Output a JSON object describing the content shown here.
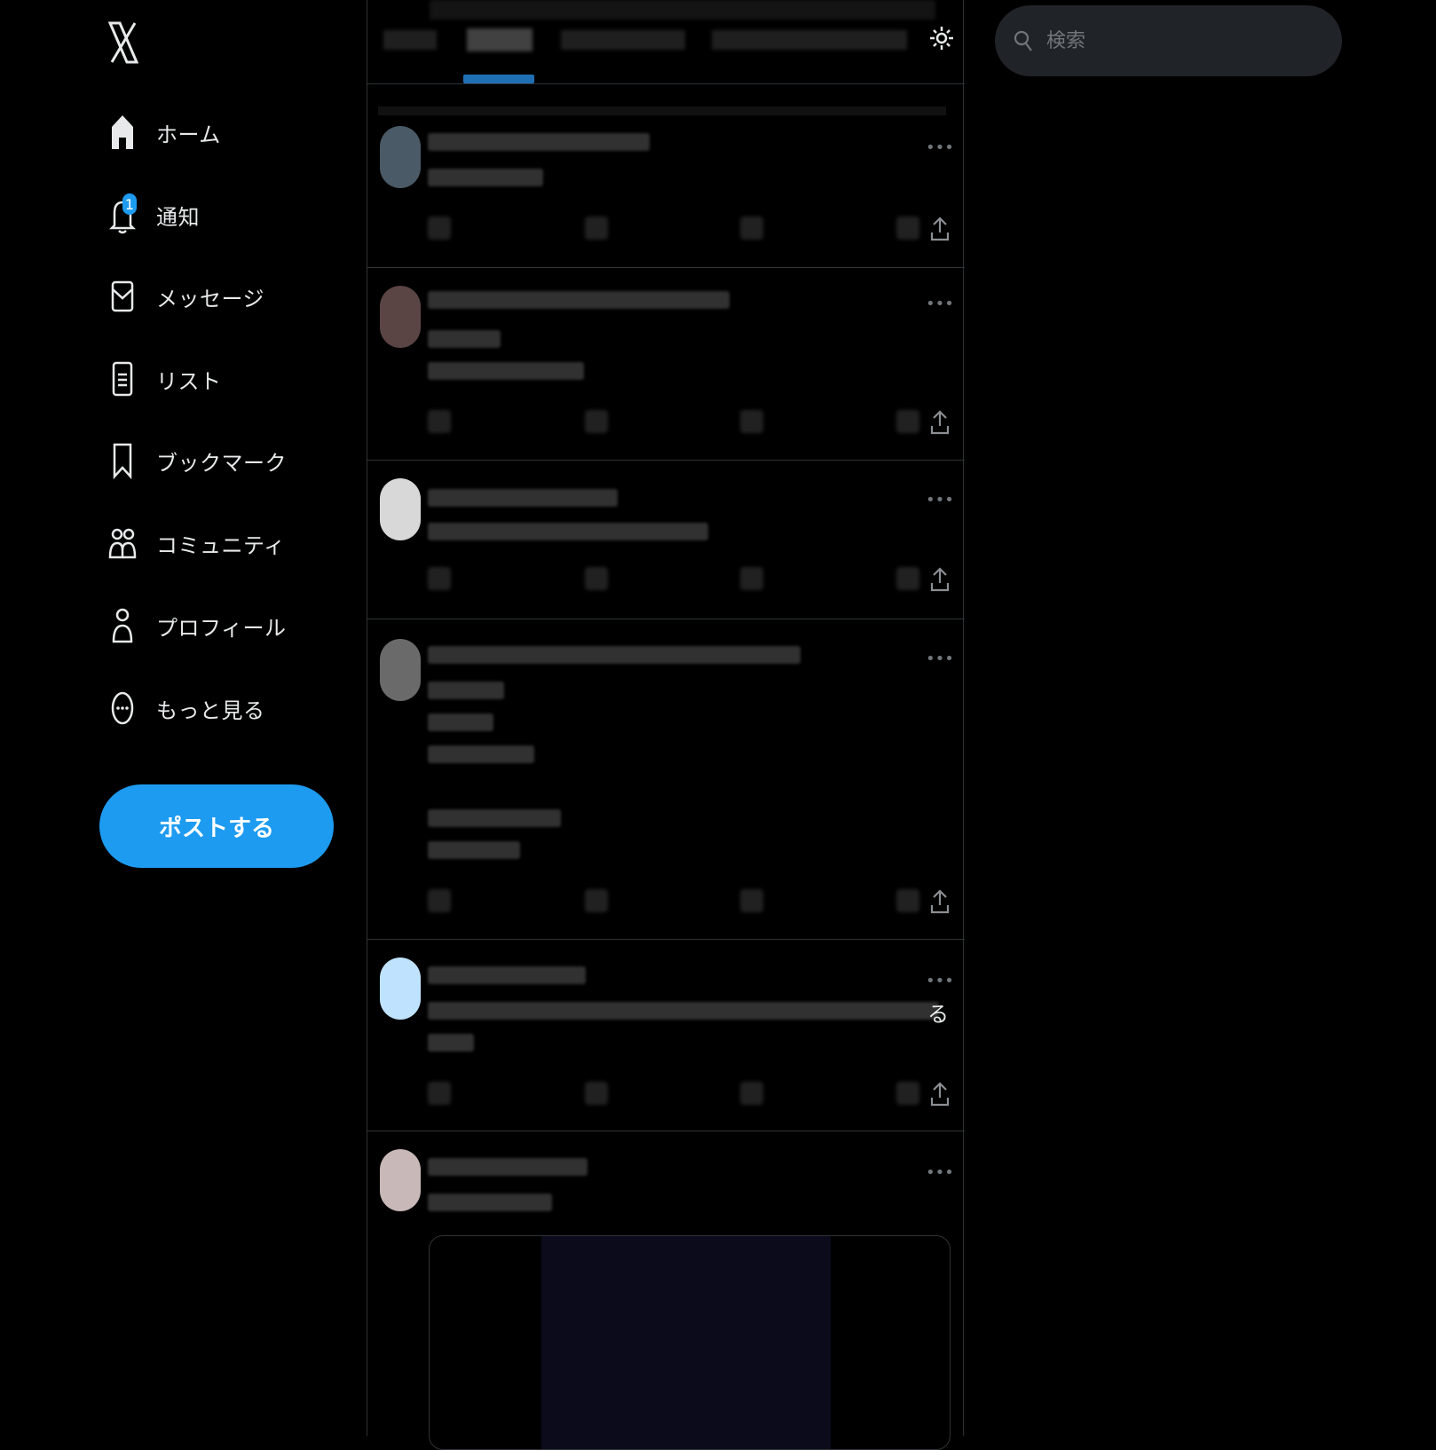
{
  "nav": {
    "items": [
      {
        "label": "ホーム",
        "icon": "home-icon"
      },
      {
        "label": "通知",
        "icon": "bell-icon",
        "badge": "1"
      },
      {
        "label": "メッセージ",
        "icon": "mail-icon"
      },
      {
        "label": "リスト",
        "icon": "list-icon"
      },
      {
        "label": "ブックマーク",
        "icon": "bookmark-icon"
      },
      {
        "label": "コミュニティ",
        "icon": "communities-icon"
      },
      {
        "label": "プロフィール",
        "icon": "profile-icon"
      },
      {
        "label": "もっと見る",
        "icon": "more-circle-icon"
      }
    ],
    "post_button": "ポストする"
  },
  "search": {
    "placeholder": "検索"
  },
  "feed": {
    "overflow_glyph": "る"
  },
  "colors": {
    "accent": "#1d9bf0",
    "background": "#000000",
    "border": "#2f3336"
  }
}
